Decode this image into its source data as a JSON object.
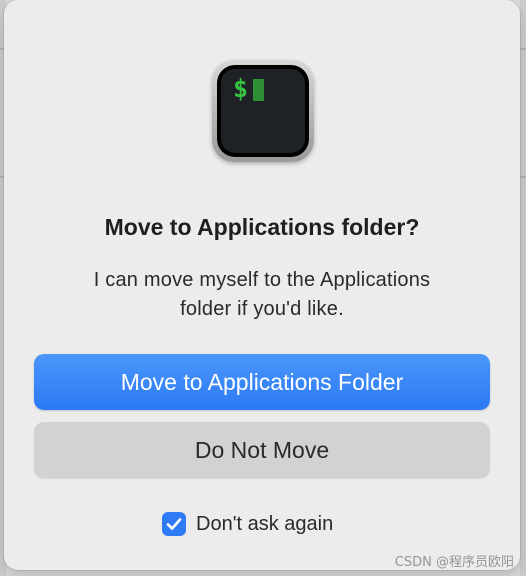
{
  "dialog": {
    "app_icon": "terminal-icon",
    "icon_prompt": "$",
    "title": "Move to Applications folder?",
    "message_line1": "I can move myself to the Applications",
    "message_line2": "folder if you'd like.",
    "primary_button": "Move to Applications Folder",
    "secondary_button": "Do Not Move",
    "checkbox_label": "Don't ask again",
    "checkbox_checked": true
  },
  "watermark": "CSDN @程序员欧阳",
  "colors": {
    "accent": "#2b79f4",
    "prompt_green": "#37c23f",
    "dialog_bg": "#ececec",
    "secondary_button_bg": "#d2d2d2"
  }
}
